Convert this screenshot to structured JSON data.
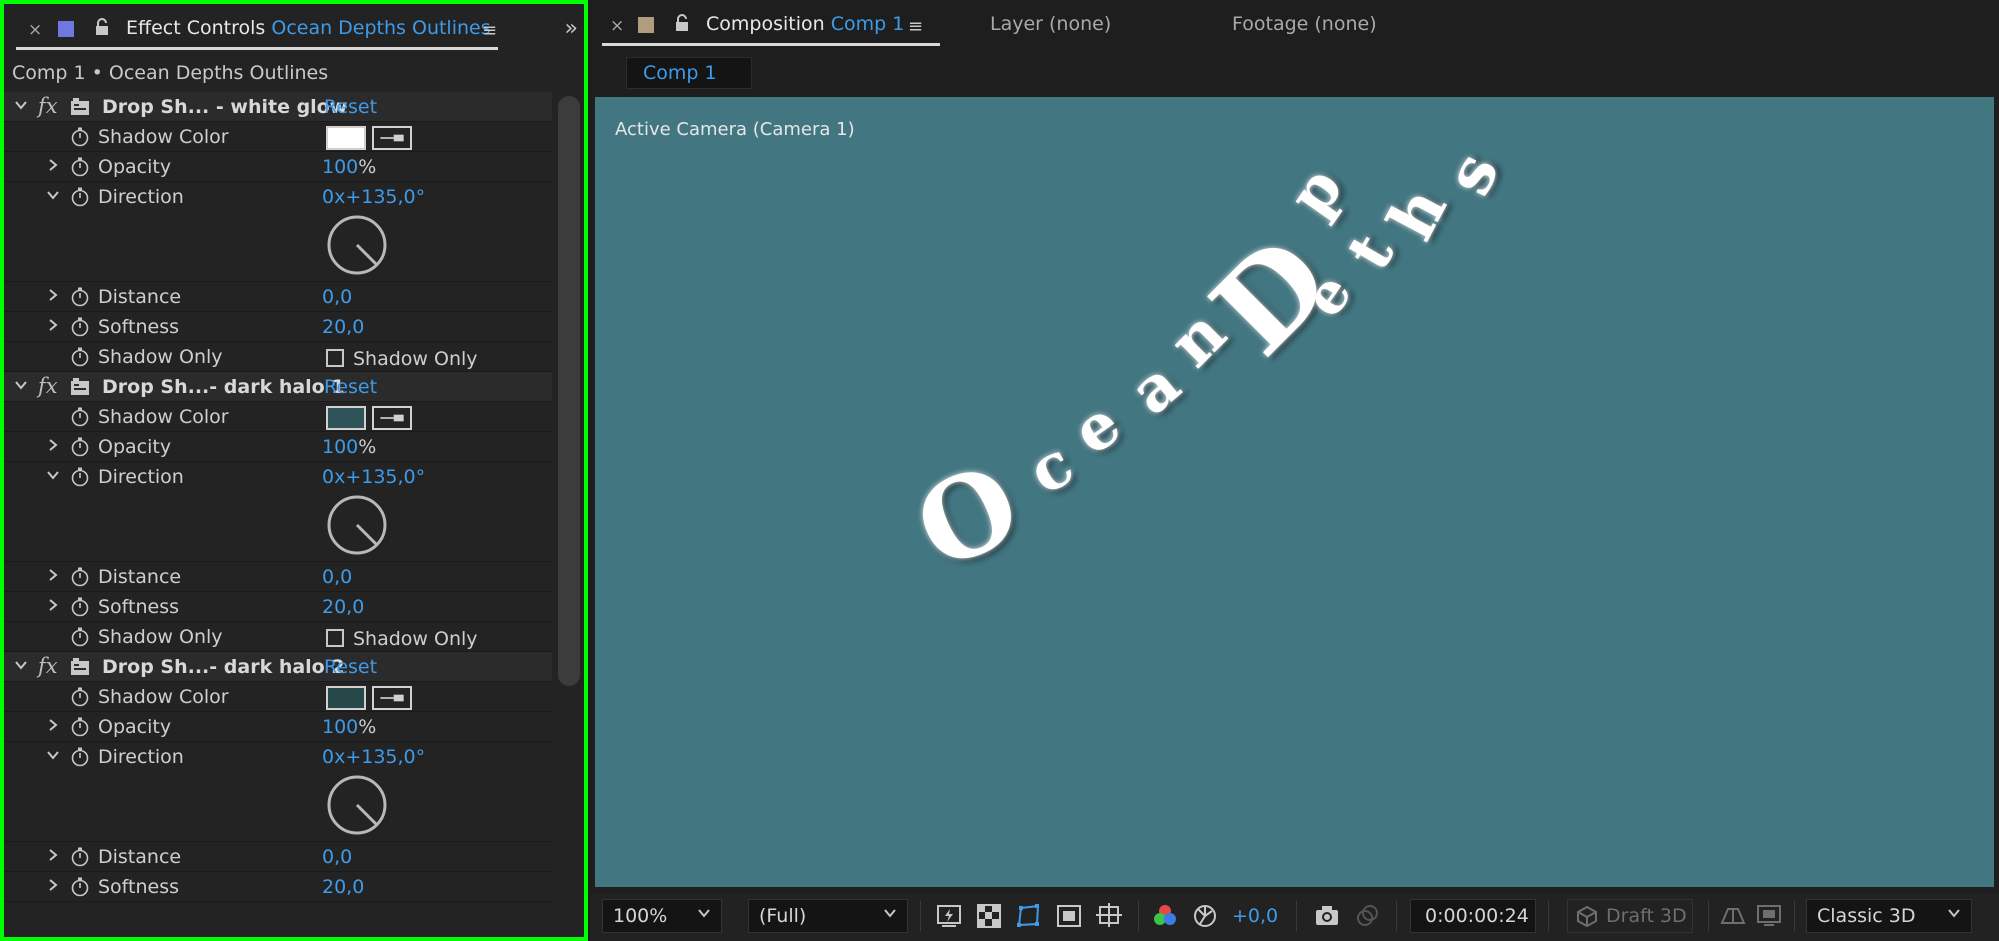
{
  "left_panel": {
    "tab": {
      "title_prefix": "Effect Controls",
      "title_layer": "Ocean Depths Outlines",
      "close_glyph": "×",
      "menu_glyph": "≡",
      "expand_glyph": "»",
      "swatch_color": "#6f78e0"
    },
    "breadcrumb": "Comp 1 • Ocean Depths Outlines",
    "effects": [
      {
        "name": "Drop Sh... - white glow",
        "reset_label": "Reset",
        "fx_label": "fx",
        "properties": {
          "shadow_color": {
            "label": "Shadow Color",
            "color": "#ffffff"
          },
          "opacity": {
            "label": "Opacity",
            "value": "100",
            "unit": "%"
          },
          "direction": {
            "label": "Direction",
            "value": "0x+135,0°"
          },
          "distance": {
            "label": "Distance",
            "value": "0,0"
          },
          "softness": {
            "label": "Softness",
            "value": "20,0"
          },
          "shadow_only": {
            "label": "Shadow Only",
            "checkbox_label": "Shadow Only",
            "checked": false
          }
        }
      },
      {
        "name": "Drop Sh...- dark halo 1",
        "reset_label": "Reset",
        "fx_label": "fx",
        "properties": {
          "shadow_color": {
            "label": "Shadow Color",
            "color": "#2f5359"
          },
          "opacity": {
            "label": "Opacity",
            "value": "100",
            "unit": "%"
          },
          "direction": {
            "label": "Direction",
            "value": "0x+135,0°"
          },
          "distance": {
            "label": "Distance",
            "value": "0,0"
          },
          "softness": {
            "label": "Softness",
            "value": "20,0"
          },
          "shadow_only": {
            "label": "Shadow Only",
            "checkbox_label": "Shadow Only",
            "checked": false
          }
        }
      },
      {
        "name": "Drop Sh...- dark halo 2",
        "reset_label": "Reset",
        "fx_label": "fx",
        "properties": {
          "shadow_color": {
            "label": "Shadow Color",
            "color": "#264849"
          },
          "opacity": {
            "label": "Opacity",
            "value": "100",
            "unit": "%"
          },
          "direction": {
            "label": "Direction",
            "value": "0x+135,0°"
          },
          "distance": {
            "label": "Distance",
            "value": "0,0"
          },
          "softness": {
            "label": "Softness",
            "value": "20,0"
          }
        }
      }
    ]
  },
  "right_panel": {
    "tab": {
      "close_glyph": "×",
      "title_prefix": "Composition",
      "title_comp": "Comp 1",
      "menu_glyph": "≡"
    },
    "layer_tab": "Layer (none)",
    "footage_tab": "Footage (none)",
    "comp_subtab": "Comp 1",
    "viewer": {
      "camera_label": "Active Camera (Camera 1)",
      "background_color": "#427681",
      "art_text": "Ocean Depths",
      "art_letters": [
        "O",
        "c",
        "e",
        "a",
        "n",
        "D",
        "e",
        "p",
        "t",
        "h",
        "s"
      ]
    },
    "toolbar": {
      "zoom": "100%",
      "resolution": "(Full)",
      "exposure": "+0,0",
      "timecode": "0:00:00:24",
      "draft3d": "Draft 3D",
      "renderer": "Classic 3D"
    }
  }
}
